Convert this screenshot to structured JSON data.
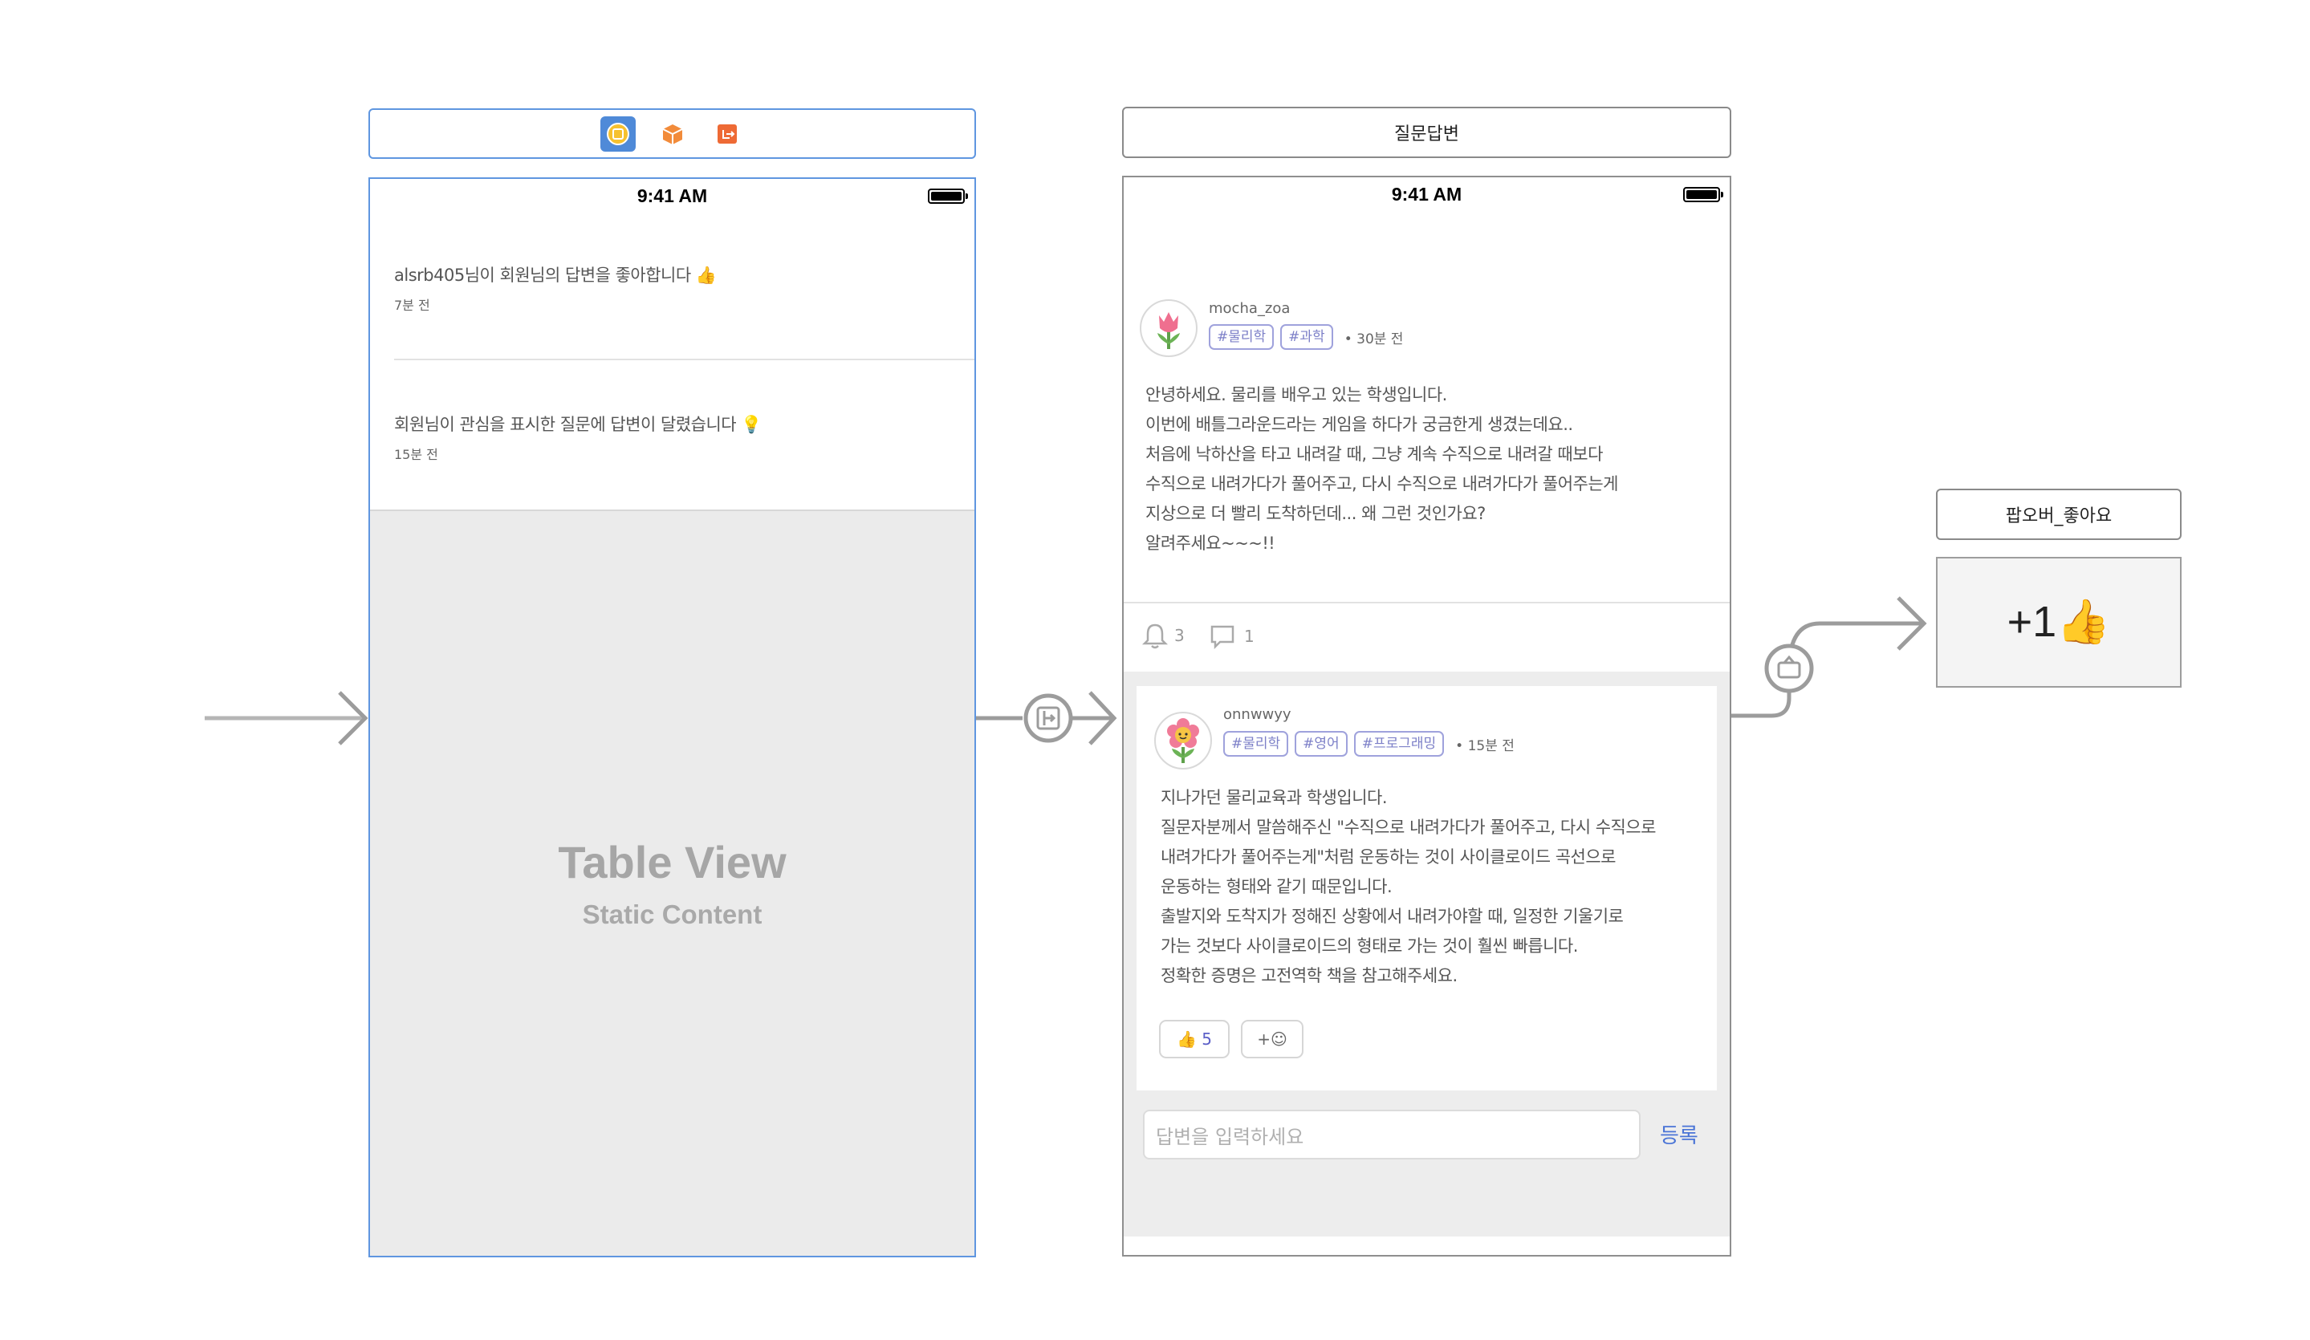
{
  "scene1": {
    "dock_icons": [
      "view-controller-icon",
      "first-responder-icon",
      "exit-icon"
    ],
    "status_time": "9:41 AM",
    "notifications": [
      {
        "text": "alsrb405님이 회원님의 답변을 좋아합니다 👍",
        "time": "7분 전"
      },
      {
        "text": "회원님이 관심을 표시한 질문에 답변이 달렸습니다 💡",
        "time": "15분 전"
      }
    ],
    "table_view_title": "Table View",
    "table_view_subtitle": "Static Content"
  },
  "scene2": {
    "title": "질문답변",
    "status_time": "9:41 AM",
    "question": {
      "username": "mocha_zoa",
      "tags": [
        "#물리학",
        "#과학"
      ],
      "time": "• 30분 전",
      "lines": [
        "안녕하세요. 물리를 배우고 있는 학생입니다.",
        "이번에 배틀그라운드라는 게임을 하다가 궁금한게 생겼는데요..",
        "처음에 낙하산을 타고 내려갈 때, 그냥 계속 수직으로 내려갈 때보다",
        "수직으로 내려가다가 풀어주고, 다시 수직으로 내려가다가 풀어주는게",
        "지상으로 더 빨리 도착하던데... 왜 그런 것인가요?",
        "알려주세요~~~!!"
      ],
      "alarm_count": "3",
      "comment_count": "1"
    },
    "answer": {
      "username": "onnwwyy",
      "tags": [
        "#물리학",
        "#영어",
        "#프로그래밍"
      ],
      "time": "• 15분 전",
      "lines": [
        "지나가던 물리교육과 학생입니다.",
        "질문자분께서 말씀해주신 \"수직으로 내려가다가 풀어주고, 다시 수직으로",
        "내려가다가 풀어주는게\"처럼 운동하는 것이 사이클로이드 곡선으로",
        "운동하는 형태와 같기 때문입니다.",
        "출발지와 도착지가 정해진 상황에서 내려가야할 때, 일정한 기울기로",
        "가는 것보다 사이클로이드의 형태로 가는 것이 훨씬 빠릅니다.",
        "정확한 증명은 고전역학 책을 참고해주세요."
      ],
      "like_count": "👍 5",
      "add_reaction": "+☺"
    },
    "input_placeholder": "답변을 입력하세요",
    "submit_label": "등록"
  },
  "scene3": {
    "title": "팝오버_좋아요",
    "content": "+1👍"
  }
}
